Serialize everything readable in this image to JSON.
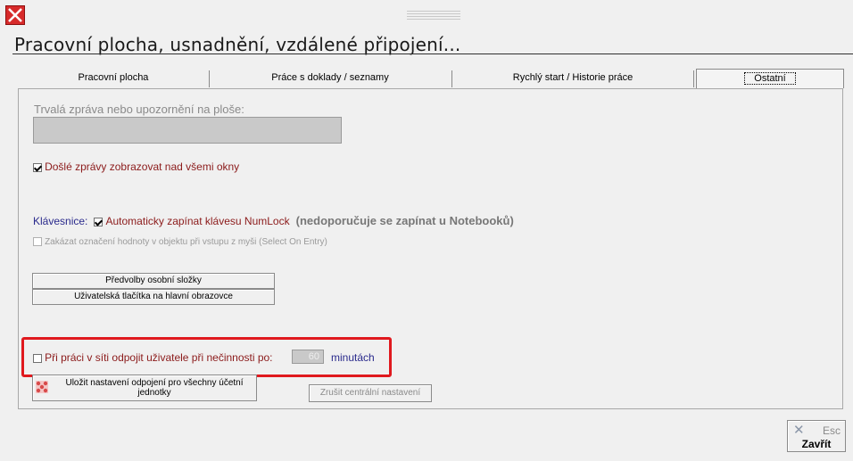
{
  "window": {
    "title": "Pracovní plocha, usnadnění, vzdálené připojení...",
    "close_icon": "close-icon"
  },
  "tabs": [
    {
      "label": "Pracovní plocha",
      "active": false
    },
    {
      "label": "Práce s doklady / seznamy",
      "active": false
    },
    {
      "label": "Rychlý start / Historie práce",
      "active": false
    },
    {
      "label": "Ostatní",
      "active": true
    }
  ],
  "panel": {
    "message_label": "Trvalá zpráva nebo upozornění na ploše:",
    "message_value": "",
    "show_messages": {
      "label": "Došlé zprávy zobrazovat nad všemi okny",
      "checked": true
    },
    "keyboard_label": "Klávesnice:",
    "numlock": {
      "label": "Automaticky zapínat klávesu NumLock",
      "checked": true
    },
    "numlock_note": "(nedoporučuje se zapínat u Notebooků)",
    "select_on_entry": {
      "label": "Zakázat označení hodnoty v objektu při vstupu z myši (Select On Entry)",
      "checked": false,
      "enabled": false
    },
    "folder_prefs_button": "Předvolby osobní složky",
    "user_buttons_button": "Uživatelská tlačítka na hlavní obrazovce",
    "disconnect": {
      "label": "Při práci v síti odpojit uživatele při nečinnosti po:",
      "checked": false,
      "minutes": "60",
      "unit": "minutách"
    },
    "save_disconnect_button": "Uložit nastavení odpojení pro všechny účetní jednotky",
    "cancel_central_button": "Zrušit centrální nastavení"
  },
  "footer": {
    "close_label": "Zavřít",
    "close_shortcut": "Esc"
  },
  "colors": {
    "highlight": "#e0191e",
    "close_red": "#d72a2a"
  }
}
